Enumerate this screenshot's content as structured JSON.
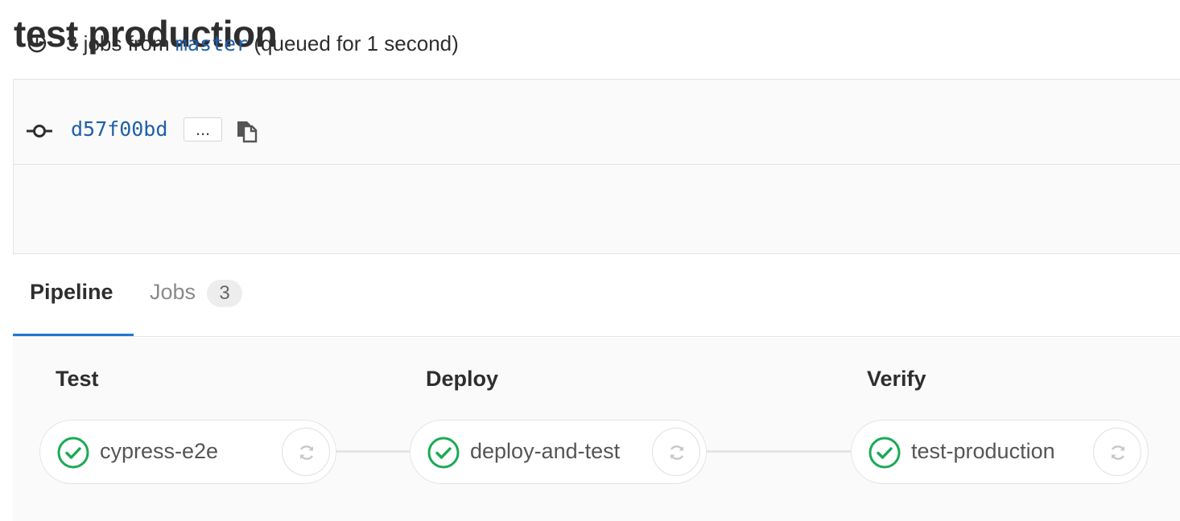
{
  "page": {
    "title": "test production"
  },
  "info": {
    "jobs_count_text": "3 jobs from",
    "branch": "master",
    "queued_text": "(queued for 1 second)",
    "commit_sha": "d57f00bd",
    "ellipsis_label": "..."
  },
  "tabs": {
    "pipeline_label": "Pipeline",
    "jobs_label": "Jobs",
    "jobs_count": "3"
  },
  "stages": [
    {
      "title": "Test",
      "job": {
        "name": "cypress-e2e",
        "status": "success"
      }
    },
    {
      "title": "Deploy",
      "job": {
        "name": "deploy-and-test",
        "status": "success"
      }
    },
    {
      "title": "Verify",
      "job": {
        "name": "test-production",
        "status": "success"
      }
    }
  ],
  "colors": {
    "success": "#1aaa55",
    "link": "#1f5fa8",
    "active_tab": "#1f78d1"
  },
  "icons": {
    "queue": "clock-icon",
    "commit": "commit-icon",
    "copy": "clipboard-icon",
    "status": "check-circle-icon",
    "retry": "retry-icon"
  }
}
